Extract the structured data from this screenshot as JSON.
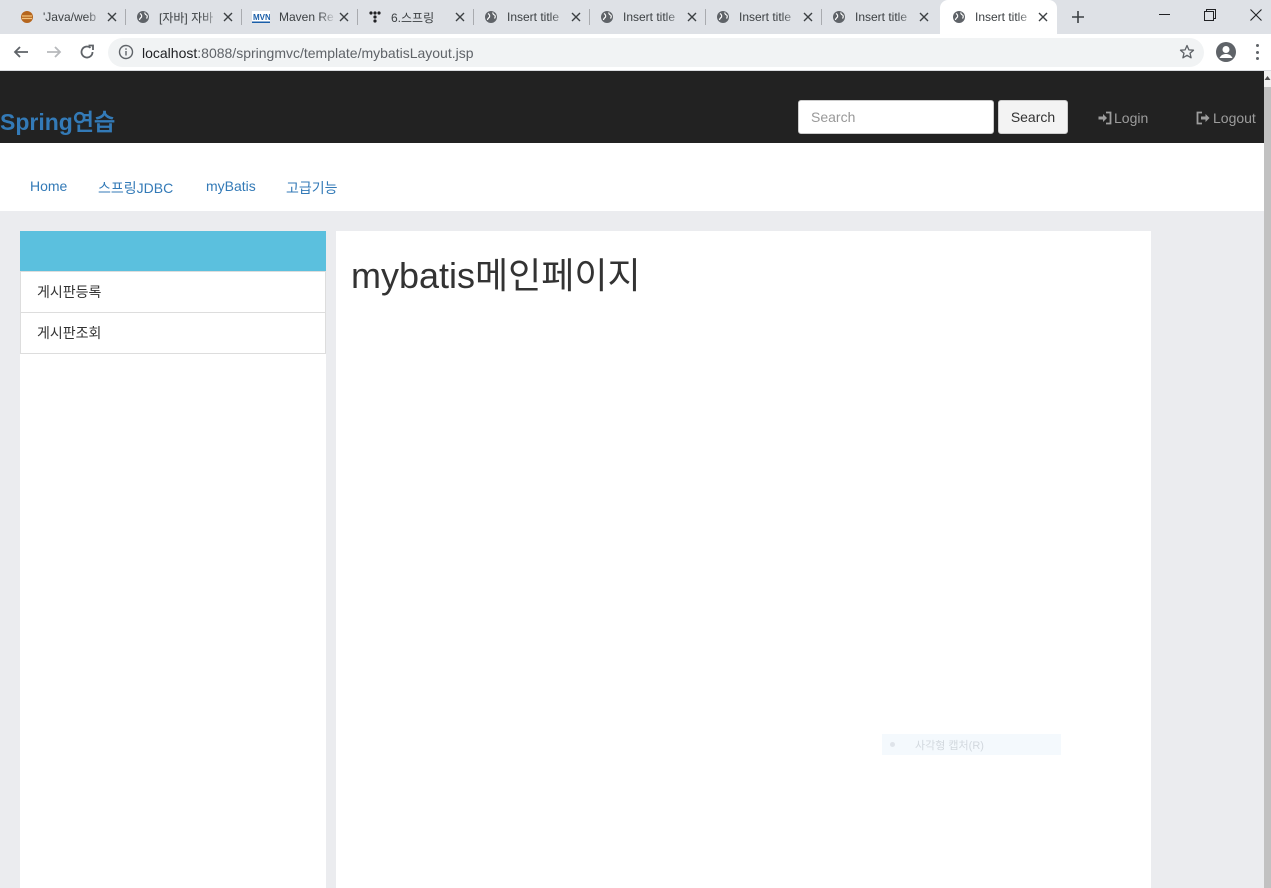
{
  "browser": {
    "tabs": [
      {
        "title": "'Java/web",
        "icon": "coffee-favicon"
      },
      {
        "title": "[자바] 자바",
        "icon": "globe-favicon"
      },
      {
        "title": "Maven Re",
        "icon": "mvn-favicon"
      },
      {
        "title": "6.스프링",
        "icon": "dots-favicon"
      },
      {
        "title": "Insert title",
        "icon": "globe-favicon"
      },
      {
        "title": "Insert title",
        "icon": "globe-favicon"
      },
      {
        "title": "Insert title",
        "icon": "globe-favicon"
      },
      {
        "title": "Insert title",
        "icon": "globe-favicon"
      },
      {
        "title": "Insert title",
        "icon": "globe-favicon",
        "active": true
      }
    ],
    "address": {
      "host": "localhost",
      "rest": ":8088/springmvc/template/mybatisLayout.jsp"
    }
  },
  "header": {
    "brand": "Spring연습",
    "search_placeholder": "Search",
    "search_button": "Search",
    "login": "Login",
    "logout": "Logout"
  },
  "nav": {
    "items": [
      "Home",
      "스프링JDBC",
      "myBatis",
      "고급기능"
    ]
  },
  "sidebar": {
    "items": [
      "게시판등록",
      "게시판조회"
    ]
  },
  "main": {
    "title": "mybatis메인페이지",
    "overlay_text": "사각형 캡처(R)"
  },
  "colors": {
    "brand": "#337ab7",
    "header_bg": "#222222",
    "sidebar_head": "#5bc0de",
    "page_bg": "#ebecef"
  }
}
